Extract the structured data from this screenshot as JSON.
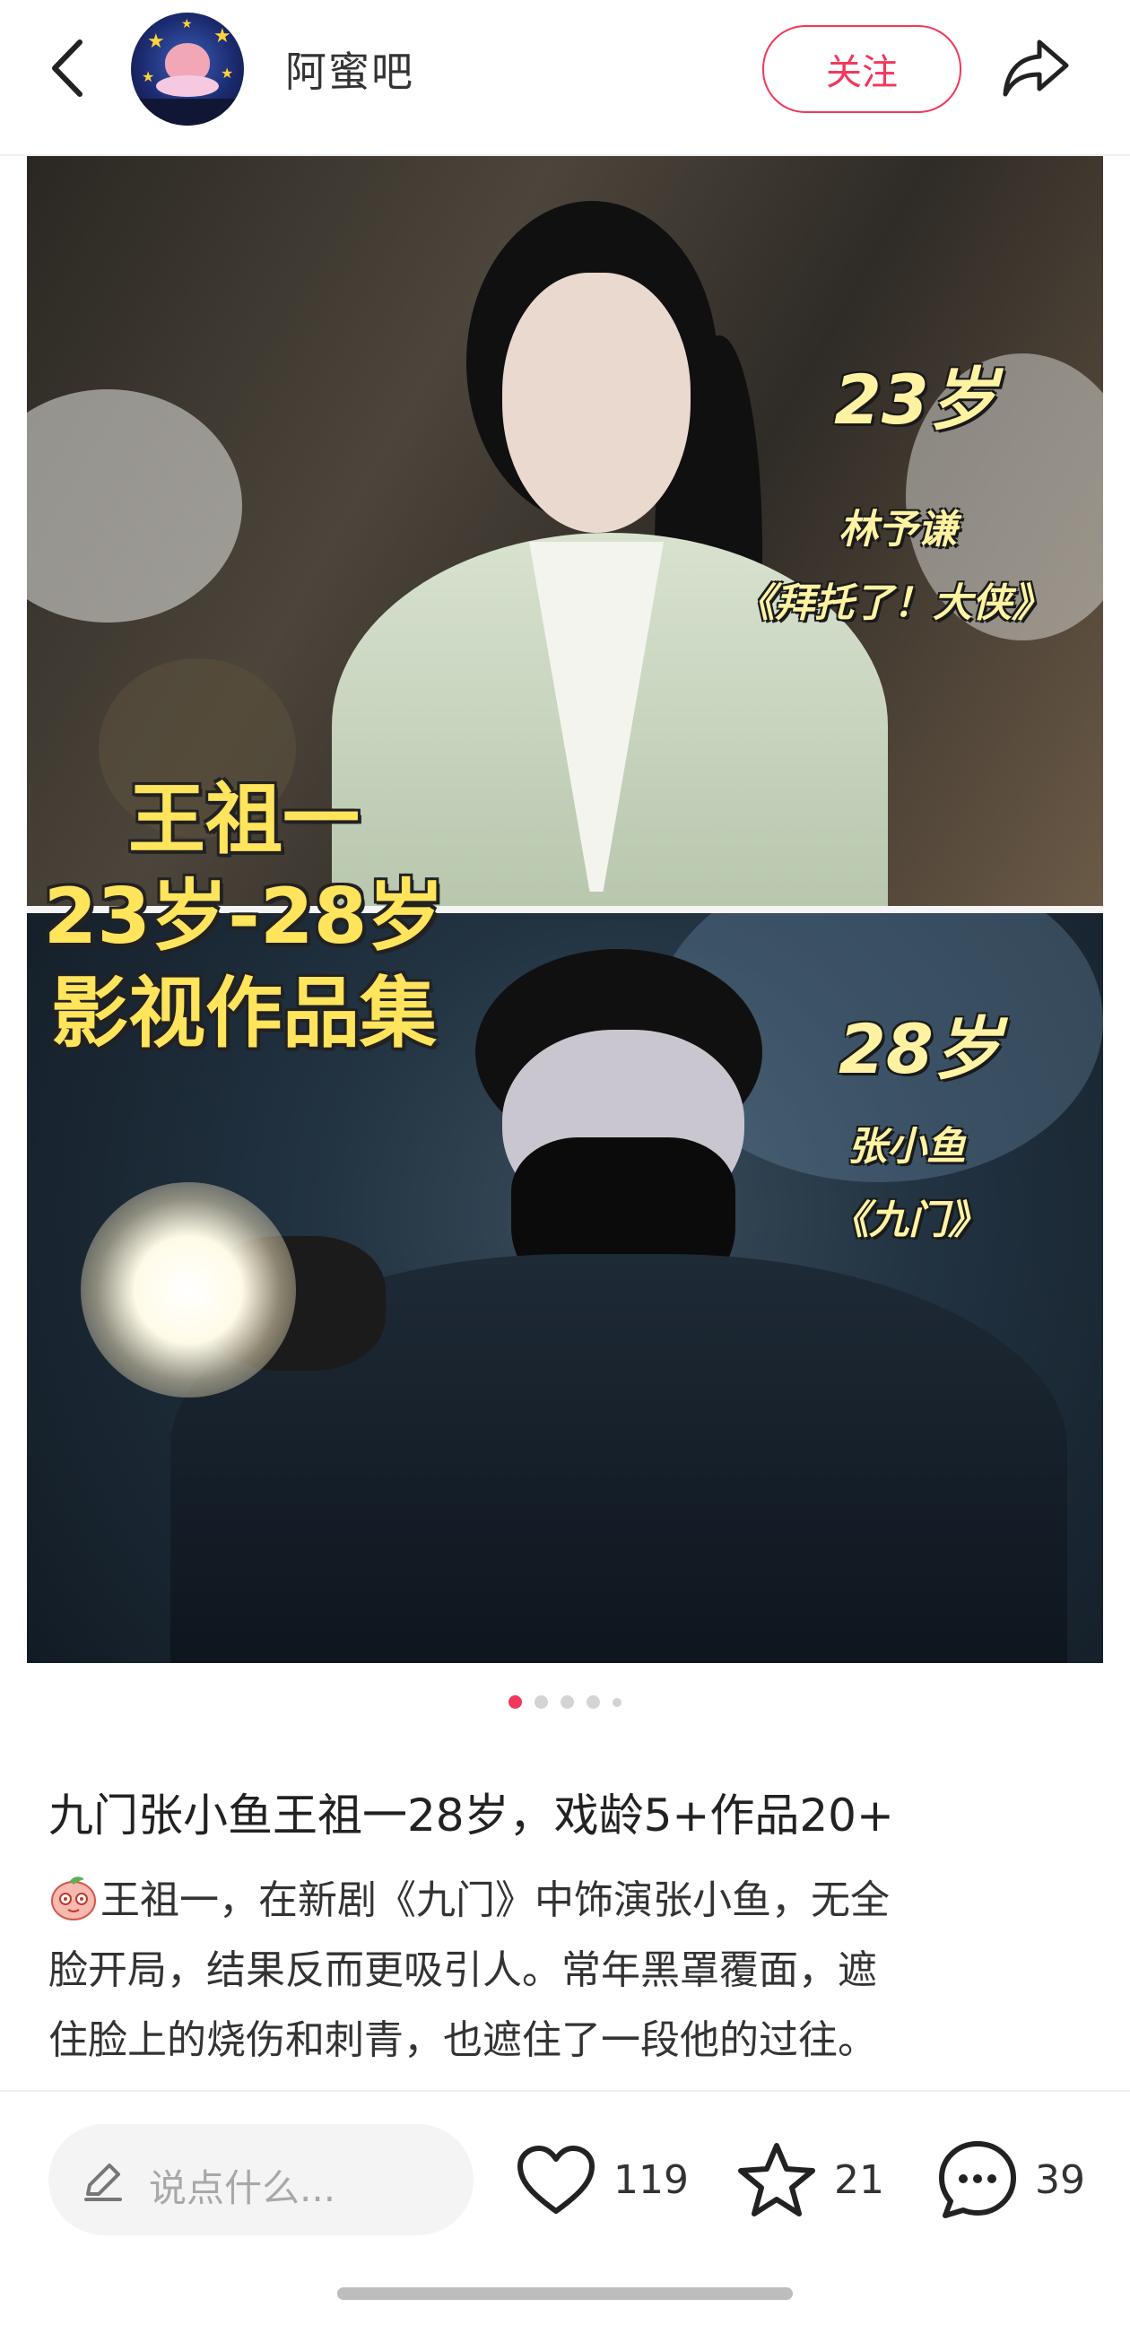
{
  "header": {
    "blog_name": "阿蜜吧",
    "follow_label": "关注",
    "back_icon": "chevron-left-icon",
    "share_icon": "share-arrow-icon"
  },
  "hero": {
    "main_caption_lines": [
      "王祖一",
      "23岁-28岁",
      "影视作品集"
    ],
    "top_panel": {
      "age": "23岁",
      "role": "林予谦",
      "work": "《拜托了！大侠》"
    },
    "bottom_panel": {
      "age": "28岁",
      "role": "张小鱼",
      "work": "《九门》"
    }
  },
  "pager": {
    "total": 5,
    "active_index": 0
  },
  "post": {
    "title": "九门张小鱼王祖一28岁，戏龄5+作品20+",
    "body_lines": [
      "王祖一，在新剧《九门》中饰演张小鱼，无全",
      "脸开局，结果反而更吸引人。常年黑罩覆面，遮",
      "住脸上的烧伤和刺青，也遮住了一段他的过往。"
    ]
  },
  "actions": {
    "comment_placeholder": "说点什么...",
    "likes": "119",
    "favorites": "21",
    "comments": "39"
  },
  "colors": {
    "accent": "#f2375a",
    "caption_yellow": "#ffe45c"
  }
}
